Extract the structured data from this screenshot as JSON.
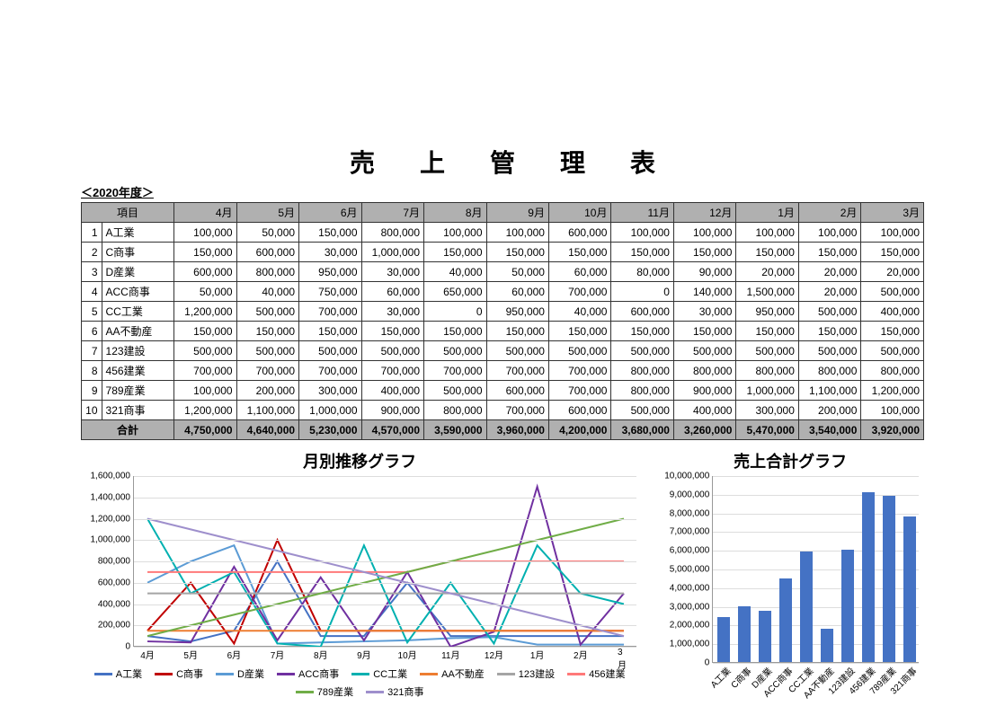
{
  "page_title": "売上管理表",
  "subtitle": "＜2020年度＞",
  "header_item": "項目",
  "months": [
    "4月",
    "5月",
    "6月",
    "7月",
    "8月",
    "9月",
    "10月",
    "11月",
    "12月",
    "1月",
    "2月",
    "3月"
  ],
  "rows": [
    {
      "num": 1,
      "name": "A工業",
      "vals": [
        100000,
        50000,
        150000,
        800000,
        100000,
        100000,
        600000,
        100000,
        100000,
        100000,
        100000,
        100000
      ]
    },
    {
      "num": 2,
      "name": "C商事",
      "vals": [
        150000,
        600000,
        30000,
        1000000,
        150000,
        150000,
        150000,
        150000,
        150000,
        150000,
        150000,
        150000
      ]
    },
    {
      "num": 3,
      "name": "D産業",
      "vals": [
        600000,
        800000,
        950000,
        30000,
        40000,
        50000,
        60000,
        80000,
        90000,
        20000,
        20000,
        20000
      ]
    },
    {
      "num": 4,
      "name": "ACC商事",
      "vals": [
        50000,
        40000,
        750000,
        60000,
        650000,
        60000,
        700000,
        0,
        140000,
        1500000,
        20000,
        500000
      ]
    },
    {
      "num": 5,
      "name": "CC工業",
      "vals": [
        1200000,
        500000,
        700000,
        30000,
        0,
        950000,
        40000,
        600000,
        30000,
        950000,
        500000,
        400000
      ]
    },
    {
      "num": 6,
      "name": "AA不動産",
      "vals": [
        150000,
        150000,
        150000,
        150000,
        150000,
        150000,
        150000,
        150000,
        150000,
        150000,
        150000,
        150000
      ]
    },
    {
      "num": 7,
      "name": "123建設",
      "vals": [
        500000,
        500000,
        500000,
        500000,
        500000,
        500000,
        500000,
        500000,
        500000,
        500000,
        500000,
        500000
      ]
    },
    {
      "num": 8,
      "name": "456建業",
      "vals": [
        700000,
        700000,
        700000,
        700000,
        700000,
        700000,
        700000,
        800000,
        800000,
        800000,
        800000,
        800000
      ]
    },
    {
      "num": 9,
      "name": "789産業",
      "vals": [
        100000,
        200000,
        300000,
        400000,
        500000,
        600000,
        700000,
        800000,
        900000,
        1000000,
        1100000,
        1200000
      ]
    },
    {
      "num": 10,
      "name": "321商事",
      "vals": [
        1200000,
        1100000,
        1000000,
        900000,
        800000,
        700000,
        600000,
        500000,
        400000,
        300000,
        200000,
        100000
      ]
    }
  ],
  "total_label": "合計",
  "totals": [
    4750000,
    4640000,
    5230000,
    4570000,
    3590000,
    3960000,
    4200000,
    3680000,
    3260000,
    5470000,
    3540000,
    3920000
  ],
  "chart1_title": "月別推移グラフ",
  "chart2_title": "売上合計グラフ",
  "line_colors": [
    "#4472c4",
    "#c00000",
    "#5b9bd5",
    "#7030a0",
    "#00b0b0",
    "#ed7d31",
    "#a5a5a5",
    "#ff7979",
    "#70ad47",
    "#9e8fcc"
  ],
  "bar_totals": [
    2400000,
    2980000,
    2760000,
    4470000,
    5900000,
    1800000,
    6000000,
    9100000,
    8900000,
    7800000
  ],
  "chart_data": {
    "type": "line",
    "title": "月別推移グラフ",
    "xlabel": "",
    "ylabel": "",
    "ylim": [
      0,
      1600000
    ],
    "categories": [
      "4月",
      "5月",
      "6月",
      "7月",
      "8月",
      "9月",
      "10月",
      "11月",
      "12月",
      "1月",
      "2月",
      "3月"
    ],
    "series": [
      {
        "name": "A工業",
        "values": [
          100000,
          50000,
          150000,
          800000,
          100000,
          100000,
          600000,
          100000,
          100000,
          100000,
          100000,
          100000
        ]
      },
      {
        "name": "C商事",
        "values": [
          150000,
          600000,
          30000,
          1000000,
          150000,
          150000,
          150000,
          150000,
          150000,
          150000,
          150000,
          150000
        ]
      },
      {
        "name": "D産業",
        "values": [
          600000,
          800000,
          950000,
          30000,
          40000,
          50000,
          60000,
          80000,
          90000,
          20000,
          20000,
          20000
        ]
      },
      {
        "name": "ACC商事",
        "values": [
          50000,
          40000,
          750000,
          60000,
          650000,
          60000,
          700000,
          0,
          140000,
          1500000,
          20000,
          500000
        ]
      },
      {
        "name": "CC工業",
        "values": [
          1200000,
          500000,
          700000,
          30000,
          0,
          950000,
          40000,
          600000,
          30000,
          950000,
          500000,
          400000
        ]
      },
      {
        "name": "AA不動産",
        "values": [
          150000,
          150000,
          150000,
          150000,
          150000,
          150000,
          150000,
          150000,
          150000,
          150000,
          150000,
          150000
        ]
      },
      {
        "name": "123建設",
        "values": [
          500000,
          500000,
          500000,
          500000,
          500000,
          500000,
          500000,
          500000,
          500000,
          500000,
          500000,
          500000
        ]
      },
      {
        "name": "456建業",
        "values": [
          700000,
          700000,
          700000,
          700000,
          700000,
          700000,
          700000,
          800000,
          800000,
          800000,
          800000,
          800000
        ]
      },
      {
        "name": "789産業",
        "values": [
          100000,
          200000,
          300000,
          400000,
          500000,
          600000,
          700000,
          800000,
          900000,
          1000000,
          1100000,
          1200000
        ]
      },
      {
        "name": "321商事",
        "values": [
          1200000,
          1100000,
          1000000,
          900000,
          800000,
          700000,
          600000,
          500000,
          400000,
          300000,
          200000,
          100000
        ]
      }
    ],
    "bar_chart": {
      "type": "bar",
      "title": "売上合計グラフ",
      "ylim": [
        0,
        10000000
      ],
      "categories": [
        "A工業",
        "C商事",
        "D産業",
        "ACC商事",
        "CC工業",
        "AA不動産",
        "123建設",
        "456建業",
        "789産業",
        "321商事"
      ],
      "values": [
        2400000,
        2980000,
        2760000,
        4470000,
        5900000,
        1800000,
        6000000,
        9100000,
        8900000,
        7800000
      ]
    }
  }
}
